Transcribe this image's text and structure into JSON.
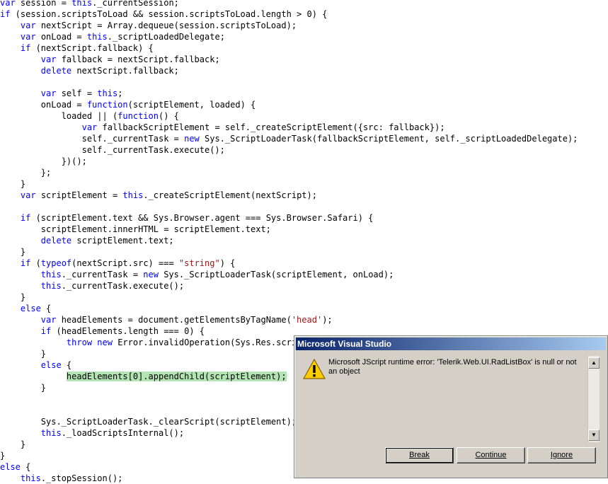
{
  "code": {
    "lines": [
      [
        {
          "t": "var",
          "c": "kw"
        },
        {
          "t": " session = "
        },
        {
          "t": "this",
          "c": "kw"
        },
        {
          "t": "._currentSession;"
        }
      ],
      [
        {
          "t": "if",
          "c": "kw"
        },
        {
          "t": " (session.scriptsToLoad && session.scriptsToLoad.length > 0) {"
        }
      ],
      [
        {
          "t": "    "
        },
        {
          "t": "var",
          "c": "kw"
        },
        {
          "t": " nextScript = Array.dequeue(session.scriptsToLoad);"
        }
      ],
      [
        {
          "t": "    "
        },
        {
          "t": "var",
          "c": "kw"
        },
        {
          "t": " onLoad = "
        },
        {
          "t": "this",
          "c": "kw"
        },
        {
          "t": "._scriptLoadedDelegate;"
        }
      ],
      [
        {
          "t": "    "
        },
        {
          "t": "if",
          "c": "kw"
        },
        {
          "t": " (nextScript.fallback) {"
        }
      ],
      [
        {
          "t": "        "
        },
        {
          "t": "var",
          "c": "kw"
        },
        {
          "t": " fallback = nextScript.fallback;"
        }
      ],
      [
        {
          "t": "        "
        },
        {
          "t": "delete",
          "c": "kw"
        },
        {
          "t": " nextScript.fallback;"
        }
      ],
      [
        {
          "t": ""
        }
      ],
      [
        {
          "t": "        "
        },
        {
          "t": "var",
          "c": "kw"
        },
        {
          "t": " self = "
        },
        {
          "t": "this",
          "c": "kw"
        },
        {
          "t": ";"
        }
      ],
      [
        {
          "t": "        onLoad = "
        },
        {
          "t": "function",
          "c": "kw"
        },
        {
          "t": "(scriptElement, loaded) {"
        }
      ],
      [
        {
          "t": "            loaded || ("
        },
        {
          "t": "function",
          "c": "kw"
        },
        {
          "t": "() {"
        }
      ],
      [
        {
          "t": "                "
        },
        {
          "t": "var",
          "c": "kw"
        },
        {
          "t": " fallbackScriptElement = self._createScriptElement({src: fallback});"
        }
      ],
      [
        {
          "t": "                self._currentTask = "
        },
        {
          "t": "new",
          "c": "kw"
        },
        {
          "t": " Sys._ScriptLoaderTask(fallbackScriptElement, self._scriptLoadedDelegate);"
        }
      ],
      [
        {
          "t": "                self._currentTask.execute();"
        }
      ],
      [
        {
          "t": "            })();"
        }
      ],
      [
        {
          "t": "        };"
        }
      ],
      [
        {
          "t": "    }"
        }
      ],
      [
        {
          "t": "    "
        },
        {
          "t": "var",
          "c": "kw"
        },
        {
          "t": " scriptElement = "
        },
        {
          "t": "this",
          "c": "kw"
        },
        {
          "t": "._createScriptElement(nextScript);"
        }
      ],
      [
        {
          "t": ""
        }
      ],
      [
        {
          "t": "    "
        },
        {
          "t": "if",
          "c": "kw"
        },
        {
          "t": " (scriptElement.text && Sys.Browser.agent === Sys.Browser.Safari) {"
        }
      ],
      [
        {
          "t": "        scriptElement.innerHTML = scriptElement.text;"
        }
      ],
      [
        {
          "t": "        "
        },
        {
          "t": "delete",
          "c": "kw"
        },
        {
          "t": " scriptElement.text;"
        }
      ],
      [
        {
          "t": "    }"
        }
      ],
      [
        {
          "t": "    "
        },
        {
          "t": "if",
          "c": "kw"
        },
        {
          "t": " ("
        },
        {
          "t": "typeof",
          "c": "kw"
        },
        {
          "t": "(nextScript.src) === "
        },
        {
          "t": "\"string\"",
          "c": "str"
        },
        {
          "t": ") {"
        }
      ],
      [
        {
          "t": "        "
        },
        {
          "t": "this",
          "c": "kw"
        },
        {
          "t": "._currentTask = "
        },
        {
          "t": "new",
          "c": "kw"
        },
        {
          "t": " Sys._ScriptLoaderTask(scriptElement, onLoad);"
        }
      ],
      [
        {
          "t": "        "
        },
        {
          "t": "this",
          "c": "kw"
        },
        {
          "t": "._currentTask.execute();"
        }
      ],
      [
        {
          "t": "    }"
        }
      ],
      [
        {
          "t": "    "
        },
        {
          "t": "else",
          "c": "kw"
        },
        {
          "t": " {"
        }
      ],
      [
        {
          "t": "        "
        },
        {
          "t": "var",
          "c": "kw"
        },
        {
          "t": " headElements = document.getElementsByTagName("
        },
        {
          "t": "'head'",
          "c": "str"
        },
        {
          "t": ");"
        }
      ],
      [
        {
          "t": "        "
        },
        {
          "t": "if",
          "c": "kw"
        },
        {
          "t": " (headElements.length === 0) {"
        }
      ],
      [
        {
          "t": "             "
        },
        {
          "t": "throw",
          "c": "kw"
        },
        {
          "t": " "
        },
        {
          "t": "new",
          "c": "kw"
        },
        {
          "t": " Error.invalidOperation(Sys.Res.scri"
        }
      ],
      [
        {
          "t": "        }"
        }
      ],
      [
        {
          "t": "        "
        },
        {
          "t": "else",
          "c": "kw"
        },
        {
          "t": " {"
        }
      ],
      [
        {
          "t": "             "
        },
        {
          "t": "headElements[0].appendChild(scriptElement);",
          "c": "hl"
        }
      ],
      [
        {
          "t": "        }"
        }
      ],
      [
        {
          "t": ""
        }
      ],
      [
        {
          "t": ""
        }
      ],
      [
        {
          "t": "        Sys._ScriptLoaderTask._clearScript(scriptElement);"
        }
      ],
      [
        {
          "t": "        "
        },
        {
          "t": "this",
          "c": "kw"
        },
        {
          "t": "._loadScriptsInternal();"
        }
      ],
      [
        {
          "t": "    }"
        }
      ],
      [
        {
          "t": "}"
        }
      ],
      [
        {
          "t": "else",
          "c": "kw"
        },
        {
          "t": " {"
        }
      ],
      [
        {
          "t": "    "
        },
        {
          "t": "this",
          "c": "kw"
        },
        {
          "t": "._stopSession();"
        }
      ]
    ]
  },
  "dialog": {
    "title": "Microsoft Visual Studio",
    "icon": "warning-icon",
    "message": "Microsoft JScript runtime error: 'Telerik.Web.UI.RadListBox' is null or not an object",
    "buttons": {
      "break_label": "Break",
      "continue_label": "Continue",
      "ignore_label": "Ignore"
    }
  },
  "colors": {
    "keyword": "#0000ff",
    "string": "#a31515",
    "highlight": "#b4e4b4",
    "titlebar_start": "#0a246a",
    "titlebar_end": "#a6caf0",
    "dialog_face": "#d4d0c8"
  }
}
